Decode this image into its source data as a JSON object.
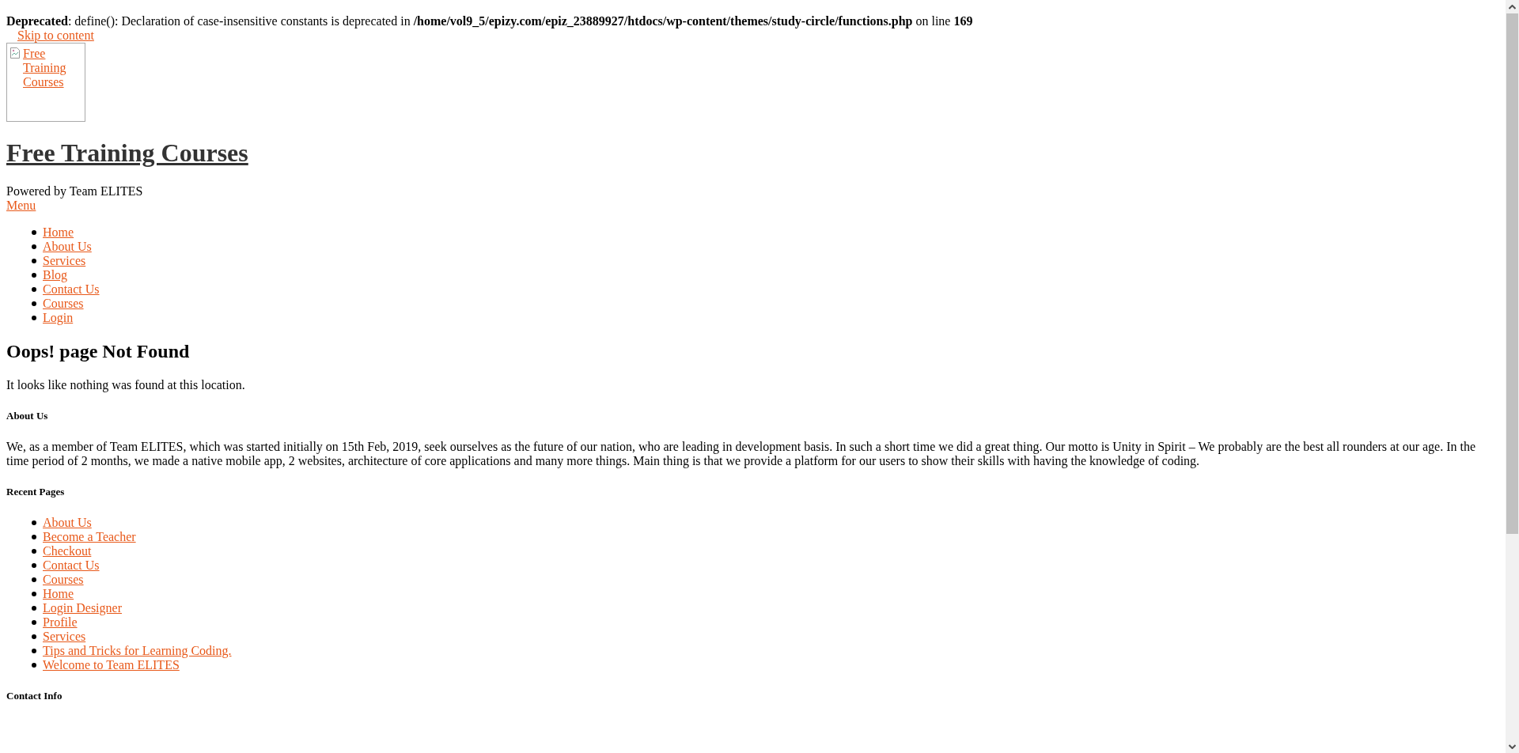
{
  "notice": "**Deprecated**: define(): Declaration of case-insensitive constants is deprecated in **/home/vol9_5/epizy.com/epiz_23889927/htdocs/wp-content/themes/study-circle/functions.php** on line **169**",
  "skip_link": "Skip to content",
  "logo": {
    "alt_text": "Free Training Courses"
  },
  "site_title": "Free Training Courses",
  "tagline": "Powered by Team ELITES",
  "menu_toggle": "Menu",
  "nav_items": [
    "Home",
    "About Us",
    "Services",
    "Blog",
    "Contact Us",
    "Courses",
    "Login"
  ],
  "error": {
    "heading": "Oops! page Not Found",
    "message": "It looks like nothing was found at this location."
  },
  "widgets": [
    {
      "kind": "text",
      "title": "About Us",
      "text": "We, as a member of Team ELITES, which was started initially on 15th Feb, 2019, seek ourselves as the future of our nation, who are leading in development basis. In such a short time we did a great thing. Our motto is Unity in Spirit – We probably are the best all rounders at our age. In the time period of 2 months, we made a native mobile app, 2 websites, architecture of core applications and many more things. Main thing is that we provide a platform for our users to show their skills with having the knowledge of coding."
    },
    {
      "kind": "list",
      "title": "Recent Pages",
      "items": [
        "About Us",
        "Become a Teacher",
        "Checkout",
        "Contact Us",
        "Courses",
        "Home",
        "Login Designer",
        "Profile",
        "Services",
        "Tips and Tricks for Learning Coding.",
        "Welcome to Team ELITES"
      ]
    },
    {
      "kind": "empty",
      "title": "Contact Info"
    }
  ]
}
